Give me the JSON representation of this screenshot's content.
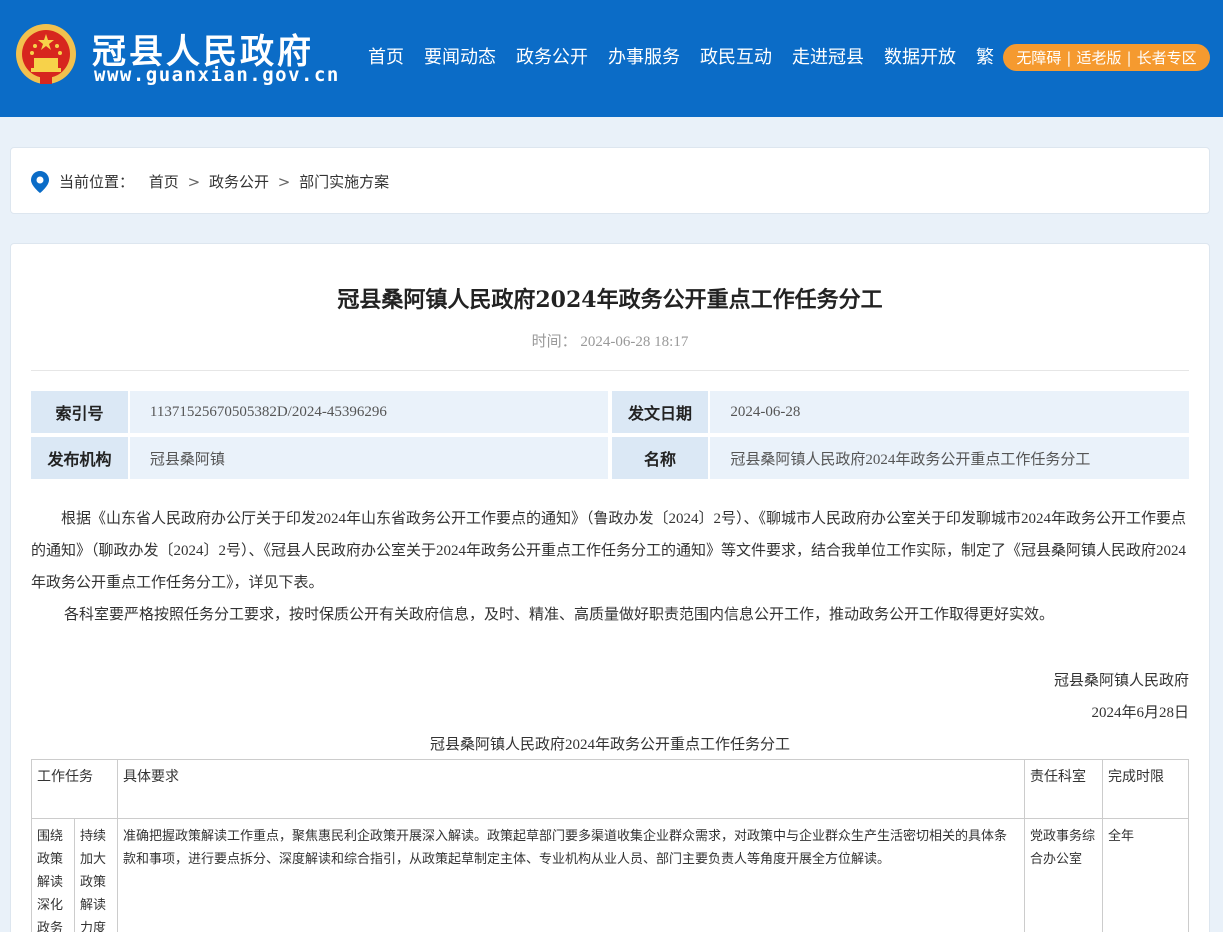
{
  "header": {
    "site_name": "冠县人民政府",
    "site_url": "www.guanxian.gov.cn",
    "nav": [
      "首页",
      "要闻动态",
      "政务公开",
      "办事服务",
      "政民互动",
      "走进冠县",
      "数据开放",
      "繁"
    ],
    "access": [
      "无障碍",
      "适老版",
      "长者专区"
    ],
    "colors": {
      "brand": "#0b6cc7",
      "access": "#f59a2f"
    }
  },
  "breadcrumb": {
    "label": "当前位置：",
    "items": [
      "首页",
      "政务公开",
      "部门实施方案"
    ]
  },
  "article": {
    "title": "冠县桑阿镇人民政府2024年政务公开重点工作任务分工",
    "time_label": "时间：",
    "time": "2024-06-28 18:17",
    "meta": {
      "index_key": "索引号",
      "index_val": "11371525670505382D/2024-45396296",
      "date_key": "发文日期",
      "date_val": "2024-06-28",
      "org_key": "发布机构",
      "org_val": "冠县桑阿镇",
      "name_key": "名称",
      "name_val": "冠县桑阿镇人民政府2024年政务公开重点工作任务分工"
    },
    "para1": "根据《山东省人民政府办公厅关于印发2024年山东省政务公开工作要点的通知》（鲁政办发〔2024〕2号）、《聊城市人民政府办公室关于印发聊城市2024年政务公开工作要点的通知》（聊政办发〔2024〕2号）、《冠县人民政府办公室关于2024年政务公开重点工作任务分工的通知》等文件要求，结合我单位工作实际，制定了《冠县桑阿镇人民政府2024年政务公开重点工作任务分工》，详见下表。",
    "para2": "各科室要严格按照任务分工要求，按时保质公开有关政府信息，及时、精准、高质量做好职责范围内信息公开工作，推动政务公开工作取得更好实效。",
    "signature": "冠县桑阿镇人民政府",
    "sign_date": "2024年6月28日",
    "table_title": "冠县桑阿镇人民政府2024年政务公开重点工作任务分工",
    "table": {
      "headers": [
        "工作任务",
        "具体要求",
        "责任科室",
        "完成时限"
      ],
      "rows": [
        {
          "task_a": "围绕政策解读深化政务",
          "task_b": "持续加大政策解读力度",
          "requirement": "准确把握政策解读工作重点，聚焦惠民利企政策开展深入解读。政策起草部门要多渠道收集企业群众需求，对政策中与企业群众生产生活密切相关的具体条款和事项，进行要点拆分、深度解读和综合指引，从政策起草制定主体、专业机构从业人员、部门主要负责人等角度开展全方位解读。",
          "dept": "党政事务综合办公室",
          "deadline": "全年"
        }
      ]
    }
  }
}
